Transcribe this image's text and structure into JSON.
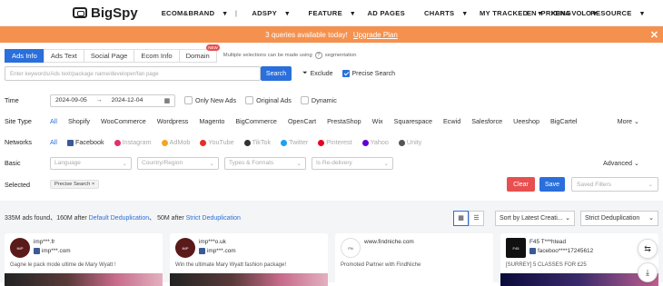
{
  "header": {
    "logo": "BigSpy",
    "nav": [
      "ECOM&BRAND",
      "ADSPY",
      "FEATURE",
      "AD PAGES",
      "CHARTS",
      "MY TRACKED",
      "PRICING",
      "RESOURCE"
    ],
    "lang": "EN",
    "user": "XENA VOLO"
  },
  "banner": {
    "text": "3 queries available today!",
    "link": "Upgrade Plan",
    "close": "✕"
  },
  "tabs": {
    "items": [
      "Ads Info",
      "Ads Text",
      "Social Page",
      "Ecom Info",
      "Domain"
    ],
    "new_badge": "NEW",
    "note": "Multiple selections can be made using",
    "note_suffix": "segmentation"
  },
  "search": {
    "placeholder": "Enter keywords/Ads text/package name/developer/fan page",
    "button": "Search",
    "exclude": "Exclude",
    "precise": "Precise Search"
  },
  "time": {
    "label": "Time",
    "start": "2024-09-05",
    "end": "2024-12-04",
    "opts": [
      "Only New Ads",
      "Original Ads",
      "Dynamic"
    ]
  },
  "site_type": {
    "label": "Site Type",
    "items": [
      "All",
      "Shopify",
      "WooCommerce",
      "Wordpress",
      "Magento",
      "BigCommerce",
      "OpenCart",
      "PrestaShop",
      "Wix",
      "Squarespace",
      "Ecwid",
      "Salesforce",
      "Ueeshop",
      "BigCartel"
    ],
    "more": "More"
  },
  "networks": {
    "label": "Networks",
    "items": [
      "All",
      "Facebook",
      "Instagram",
      "AdMob",
      "YouTube",
      "TikTok",
      "Twitter",
      "Pinterest",
      "Yahoo",
      "Unity"
    ]
  },
  "basic": {
    "label": "Basic",
    "selects": [
      "Language",
      "Country/Region",
      "Types & Formats",
      "Is Re-delivery"
    ],
    "advanced": "Advanced"
  },
  "selected": {
    "label": "Selected",
    "chip": "Precise Search",
    "clear": "Clear",
    "save": "Save",
    "saved_placeholder": "Saved Filters"
  },
  "results": {
    "prefix": "335M ads found、160M after",
    "link1": "Default Deduplication",
    "mid": "、 50M after",
    "link2": "Strict Deduplication",
    "sort": "Sort by Latest Creati...",
    "dedup": "Strict Deduplication"
  },
  "cards": [
    {
      "name": "imp***.fr",
      "sub": "imp***.com",
      "text": "Gagne le pack mode ultime de Mary Wyatt !"
    },
    {
      "name": "imp***o.uk",
      "sub": "imp***.com",
      "text": "Win the ultimate Mary Wyatt fashion package!"
    },
    {
      "name": "www.findniche.com",
      "sub": "",
      "text": "Promoted Partner with FindNiche"
    },
    {
      "name": "F45 T***htead",
      "sub": "faceboo****17245612",
      "text": "[SURREY] 5 CLASSES FOR £25"
    }
  ],
  "colors": {
    "accent": "#2a6fdb",
    "banner": "#f5914e",
    "danger": "#e84f4f"
  }
}
